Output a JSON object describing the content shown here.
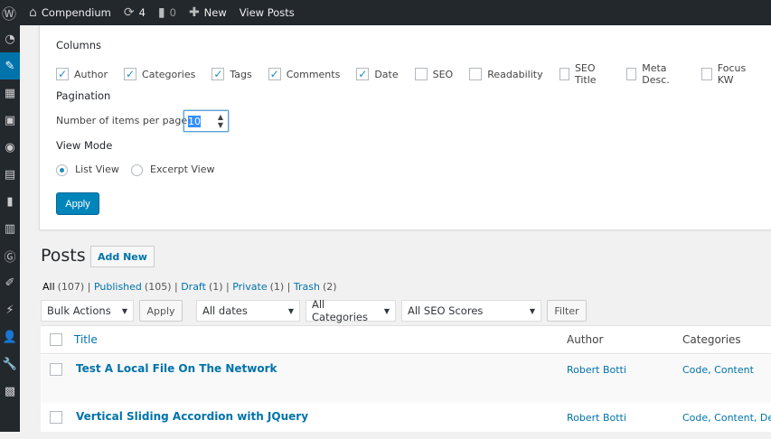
{
  "topbar": {
    "site": "Compendium",
    "updates": "4",
    "comments": "0",
    "new": "New",
    "view": "View Posts"
  },
  "screen_options": {
    "columns_heading": "Columns",
    "columns": [
      {
        "label": "Author",
        "checked": true
      },
      {
        "label": "Categories",
        "checked": true
      },
      {
        "label": "Tags",
        "checked": true
      },
      {
        "label": "Comments",
        "checked": true
      },
      {
        "label": "Date",
        "checked": true
      },
      {
        "label": "SEO",
        "checked": false
      },
      {
        "label": "Readability",
        "checked": false
      },
      {
        "label": "SEO Title",
        "checked": false
      },
      {
        "label": "Meta Desc.",
        "checked": false
      },
      {
        "label": "Focus KW",
        "checked": false
      }
    ],
    "pagination_heading": "Pagination",
    "items_label": "Number of items per page:",
    "items_value": "10",
    "view_mode_heading": "View Mode",
    "list_view": "List View",
    "excerpt_view": "Excerpt View",
    "apply": "Apply"
  },
  "posts": {
    "title": "Posts",
    "add_new": "Add New",
    "filters": [
      {
        "label": "All",
        "count": "(107)"
      },
      {
        "label": "Published",
        "count": "(105)"
      },
      {
        "label": "Draft",
        "count": "(1)"
      },
      {
        "label": "Private",
        "count": "(1)"
      },
      {
        "label": "Trash",
        "count": "(2)"
      }
    ],
    "bulk_actions": "Bulk Actions",
    "apply": "Apply",
    "dates": "All dates",
    "categories": "All Categories",
    "seo": "All SEO Scores",
    "filter": "Filter",
    "headers": {
      "title": "Title",
      "author": "Author",
      "categories": "Categories"
    },
    "rows": [
      {
        "title": "Test A Local File On The Network",
        "author": "Robert Botti",
        "categories": "Code, Content"
      },
      {
        "title": "Vertical Sliding Accordion with JQuery",
        "author": "Robert Botti",
        "categories": "Code, Content, Des"
      }
    ]
  }
}
